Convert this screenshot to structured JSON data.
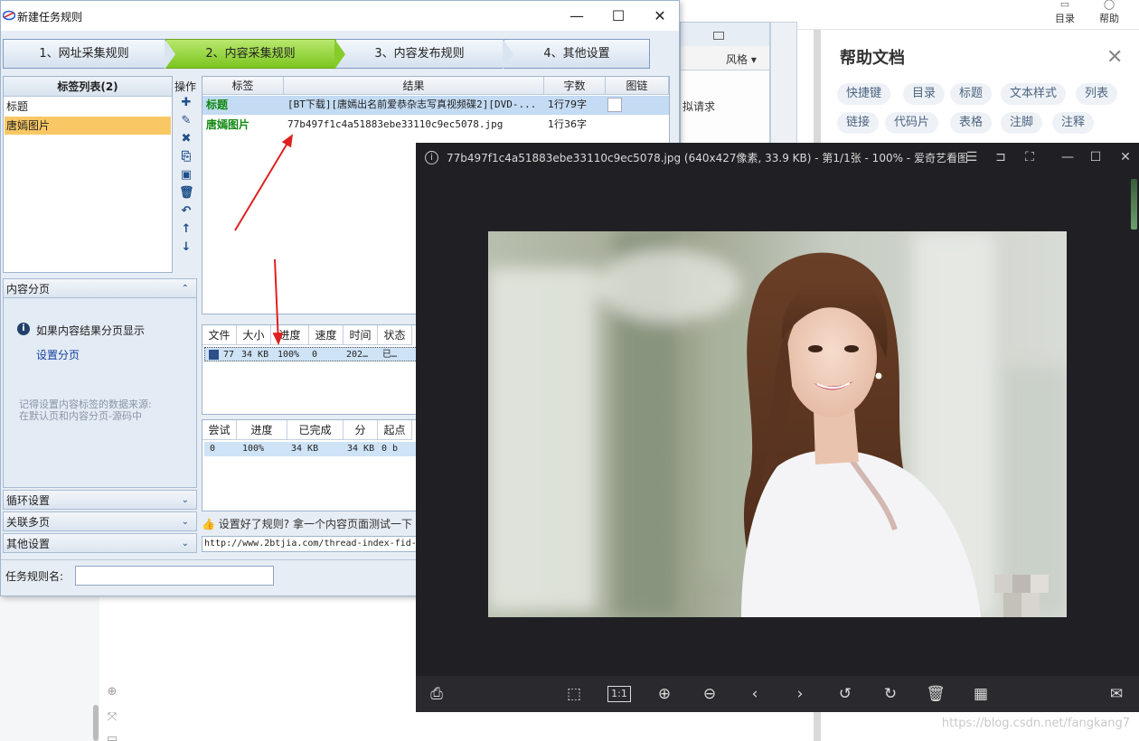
{
  "topbar": {
    "toc_label": "目录",
    "help_label": "帮助"
  },
  "help_panel": {
    "title": "帮助文档",
    "tags": [
      "快捷键",
      "目录",
      "标题",
      "文本样式",
      "列表",
      "链接",
      "代码片",
      "表格",
      "注脚",
      "注释"
    ]
  },
  "secondary_window": {
    "style_label": "风格",
    "request_label": "拟请求"
  },
  "task_window": {
    "title": "新建任务规则",
    "steps": [
      "1、网址采集规则",
      "2、内容采集规则",
      "3、内容发布规则",
      "4、其他设置"
    ],
    "active_step": 1,
    "tag_list_header": "标签列表(2)",
    "tags": [
      "标题",
      "唐嫣图片"
    ],
    "selected_tag": 1,
    "ops_label": "操作",
    "result_columns": [
      "标签",
      "结果",
      "字数",
      "图链"
    ],
    "result_rows": [
      {
        "tag": "标题",
        "result": "[BT下载][唐嫣出名前爱恭杂志写真视频碟2][DVD-...",
        "count": "1行79字"
      },
      {
        "tag": "唐嫣图片",
        "result": "77b497f1c4a51883ebe33110c9ec5078.jpg",
        "count": "1行36字"
      }
    ],
    "content_paging": {
      "header": "内容分页",
      "info_text": "如果内容结果分页显示",
      "link": "设置分页",
      "note_line1": "记得设置内容标签的数据来源:",
      "note_line2": "在默认页和内容分页-源码中"
    },
    "accordions": [
      "循环设置",
      "关联多页",
      "其他设置"
    ],
    "download_columns": [
      "文件",
      "大小",
      "进度",
      "速度",
      "时间",
      "状态"
    ],
    "download_row": {
      "file": "77",
      "size": "34 KB",
      "progress": "100%",
      "speed": "0",
      "time": "202…",
      "status": "已…"
    },
    "attempt_columns": [
      "尝试",
      "进度",
      "已完成",
      "分",
      "起点"
    ],
    "attempt_row": {
      "attempt": "0",
      "progress": "100%",
      "done": "34 KB",
      "part": "34 KB",
      "start": "0 b"
    },
    "hint": "设置好了规则? 拿一个内容页面测试一下",
    "url": "http://www.2btjia.com/thread-index-fid-",
    "name_label": "任务规则名:"
  },
  "viewer": {
    "title": "77b497f1c4a51883ebe33110c9ec5078.jpg (640x427像素, 33.9 KB) - 第1/1张 - 100% - 爱奇艺看图",
    "zoom_label": "1:1"
  },
  "watermark": "https://blog.csdn.net/fangkang7",
  "colors": {
    "active_step": "#7cc51f",
    "selected_row": "#f9c864",
    "tag_green": "#118811",
    "arrow_red": "#e02020",
    "viewer_bg": "#202024"
  }
}
